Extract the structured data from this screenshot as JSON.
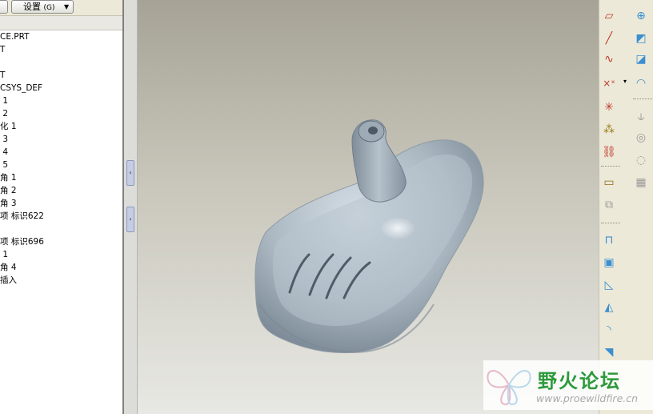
{
  "tree": {
    "settings_label": "设置",
    "settings_key": "(G)",
    "items": [
      "CE.PRT",
      "T",
      "",
      "T",
      "CSYS_DEF",
      " 1",
      " 2",
      "化 1",
      " 3",
      " 4",
      " 5",
      "角 1",
      "角 2",
      "角 3",
      "项 标识622",
      "",
      "项 标识696",
      " 1",
      "角 4",
      "插入"
    ]
  },
  "splitter": {
    "collapse_glyph": "‹",
    "expand_glyph": "›"
  },
  "colors": {
    "viewport_top": "#a6a396",
    "viewport_bottom": "#e8e8e4",
    "model_body": "#a9b6c0",
    "model_shadow": "#6f7e8b",
    "toolbar_bg": "#ece9d8",
    "watermark_title": "#2e9a3c",
    "watermark_url": "#a9a9a9",
    "toolbar_icon_blue": "#3b8fd0",
    "toolbar_icon_red": "#c0392b"
  },
  "toolbar": {
    "icons": [
      "datum-plane-icon",
      "datum-axis-toggle-icon",
      "datum-axis-icon",
      "mirror-plane-icon",
      "sketched-curve-icon",
      "surface-icon",
      "datum-point-icon",
      "boundary-blend-icon",
      "csys-icon",
      "offset-icon",
      "analysis-icon",
      "intersect-icon",
      "sketch-tool-icon",
      "project-icon",
      "note-icon",
      "pattern-icon",
      "extrude-icon",
      "shell-icon",
      "draft-icon",
      "rib-icon",
      "round-icon",
      "chamfer-icon"
    ]
  },
  "watermark": {
    "title": "野火论坛",
    "url": "www.proewildfire.cn"
  }
}
